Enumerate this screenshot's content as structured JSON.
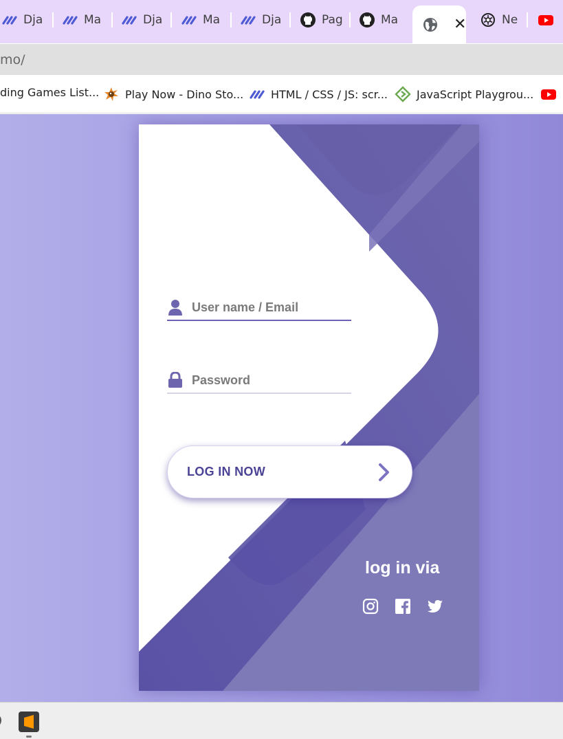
{
  "browser": {
    "tabs": [
      {
        "label": "Dja",
        "icon": "makerkit-icon"
      },
      {
        "label": "Ma",
        "icon": "makerkit-icon"
      },
      {
        "label": "Dja",
        "icon": "makerkit-icon"
      },
      {
        "label": "Ma",
        "icon": "makerkit-icon"
      },
      {
        "label": "Dja",
        "icon": "makerkit-icon"
      },
      {
        "label": "Pag",
        "icon": "github-icon"
      },
      {
        "label": "Ma",
        "icon": "github-icon"
      },
      {
        "label": "",
        "icon": "globe-icon",
        "active": true,
        "close": "✕"
      },
      {
        "label": "Ne",
        "icon": "openai-icon"
      },
      {
        "label": "",
        "icon": "youtube-icon"
      }
    ],
    "url": "mo/",
    "bookmarks": [
      {
        "label": "ding Games List..."
      },
      {
        "label": "Play Now - Dino Sto...",
        "icon": "dino-icon"
      },
      {
        "label": "HTML / CSS / JS: scr...",
        "icon": "makerkit-icon"
      },
      {
        "label": "JavaScript Playgrou...",
        "icon": "playground-icon"
      },
      {
        "label": "",
        "icon": "youtube-icon"
      }
    ]
  },
  "login": {
    "username_placeholder": "User name / Email",
    "password_placeholder": "Password",
    "button_label": "LOG IN NOW",
    "via_label": "log in via",
    "social": [
      "instagram-icon",
      "facebook-icon",
      "twitter-icon"
    ]
  },
  "colors": {
    "accent": "#5d54a4",
    "accent_light": "#7c78b8",
    "page_bg": "#a29de3"
  },
  "taskbar": {
    "apps": [
      "sublime-text-icon"
    ]
  }
}
